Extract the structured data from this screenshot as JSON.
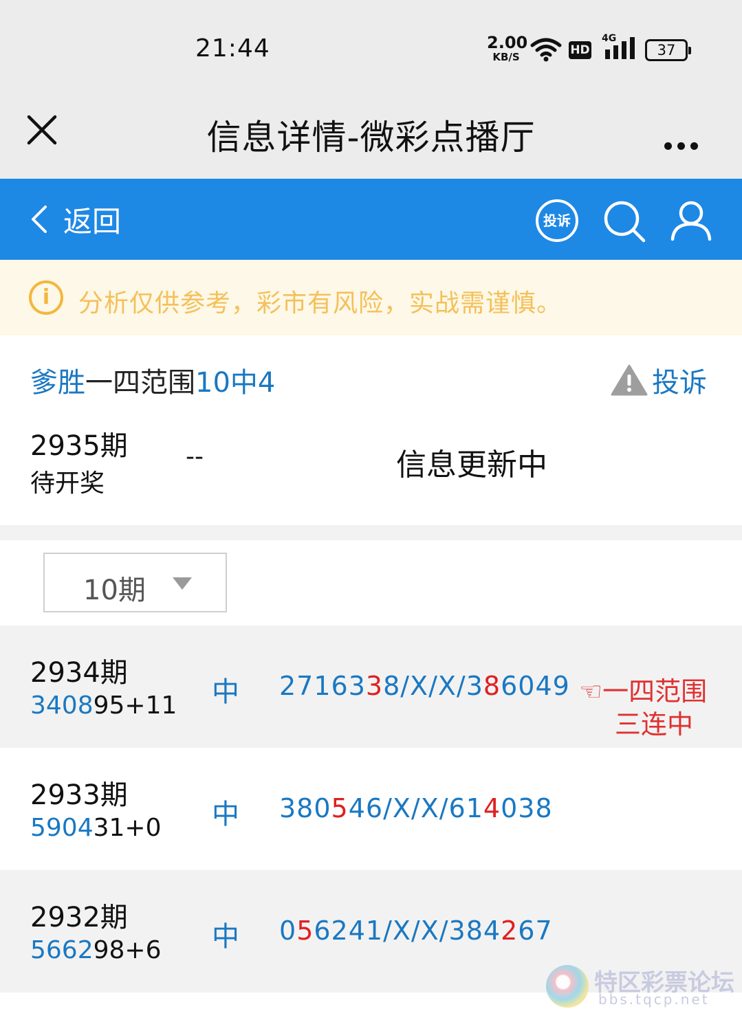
{
  "status_bar": {
    "time": "21:44",
    "net_speed": "2.00",
    "net_unit": "KB/S",
    "hd": "HD",
    "signal": "4G",
    "battery": "37"
  },
  "title_bar": {
    "title": "信息详情-微彩点播厅"
  },
  "nav": {
    "back_label": "返回",
    "complain_label": "投诉"
  },
  "notice": {
    "text": "分析仅供参考，彩市有风险，实战需谨慎。"
  },
  "info": {
    "title_prefix": "爹胜",
    "title_mid": "一四范围",
    "title_suffix": "10中4",
    "report_label": "投诉",
    "current_issue": "2935期",
    "current_status": "待开奖",
    "current_dash": "--",
    "current_update": "信息更新中"
  },
  "filter": {
    "period": "10期"
  },
  "rows": [
    {
      "issue": "2934期",
      "draw_blue": "3408",
      "draw_rest": "95+11",
      "hit": "中",
      "pred": [
        {
          "t": "27163",
          "red": false
        },
        {
          "t": "3",
          "red": true
        },
        {
          "t": "8/X/X/3",
          "red": false
        },
        {
          "t": "8",
          "red": true
        },
        {
          "t": "6049",
          "red": false
        }
      ]
    },
    {
      "issue": "2933期",
      "draw_blue": "5904",
      "draw_rest": "31+0",
      "hit": "中",
      "pred": [
        {
          "t": "380",
          "red": false
        },
        {
          "t": "5",
          "red": true
        },
        {
          "t": "46/X/X/61",
          "red": false
        },
        {
          "t": "4",
          "red": true
        },
        {
          "t": "038",
          "red": false
        }
      ]
    },
    {
      "issue": "2932期",
      "draw_blue": "5662",
      "draw_rest": "98+6",
      "hit": "中",
      "pred": [
        {
          "t": "0",
          "red": false
        },
        {
          "t": "5",
          "red": true
        },
        {
          "t": "6241/X/X/384",
          "red": false
        },
        {
          "t": "2",
          "red": true
        },
        {
          "t": "67",
          "red": false
        }
      ]
    }
  ],
  "annotation": {
    "line1": "☜一四范围",
    "line2": "三连中"
  },
  "watermark": {
    "text": "特区彩票论坛",
    "url": "bbs.tqcp.net"
  },
  "colors": {
    "nav_blue": "#1e88e5",
    "text_blue": "#1a78c2",
    "highlight_red": "#e02020",
    "notice_yellow": "#f4b63b"
  }
}
